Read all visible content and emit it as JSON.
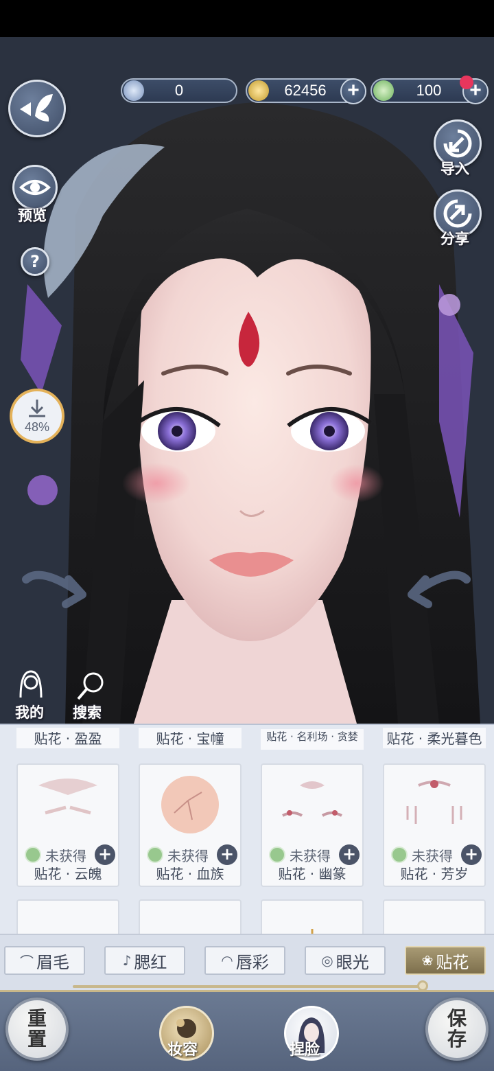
{
  "currency": {
    "jade": "0",
    "coins": "62456",
    "tokens": "100"
  },
  "side_buttons": {
    "preview_label": "预览",
    "help_glyph": "?",
    "download_percent": "48%",
    "import_label": "导入",
    "share_label": "分享",
    "mine_label": "我的",
    "search_label": "搜索"
  },
  "items": {
    "top_row_labels": [
      "贴花 · 盈盈",
      "贴花 · 宝幢",
      "贴花 · 名利场 · 贪婪",
      "贴花 · 柔光暮色"
    ],
    "cards": [
      {
        "status": "未获得",
        "name": "贴花 · 云魄"
      },
      {
        "status": "未获得",
        "name": "贴花 · 血族"
      },
      {
        "status": "未获得",
        "name": "贴花 · 幽篆"
      },
      {
        "status": "未获得",
        "name": "贴花 · 芳岁"
      }
    ]
  },
  "categories": [
    {
      "icon": "brow-icon",
      "label": "眉毛",
      "active": false
    },
    {
      "icon": "blush-icon",
      "label": "腮红",
      "active": false
    },
    {
      "icon": "lips-icon",
      "label": "唇彩",
      "active": false
    },
    {
      "icon": "eye-icon",
      "label": "眼光",
      "active": false
    },
    {
      "icon": "lotus-icon",
      "label": "贴花",
      "active": true
    }
  ],
  "bottom_nav": {
    "reset": "重置",
    "makeup": "妆容",
    "face": "捏脸",
    "save": "保存"
  },
  "colors": {
    "accent_gold": "#c8b88c",
    "panel_bg": "#e3e8f1",
    "nav_bg": "#6b7a93",
    "notification": "#e8365d"
  }
}
